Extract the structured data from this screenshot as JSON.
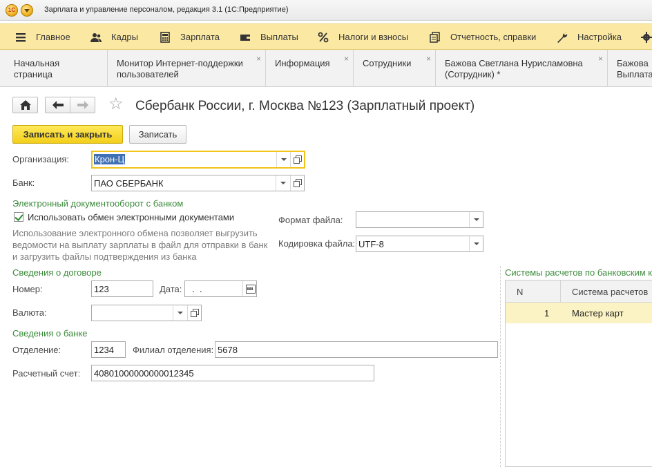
{
  "window": {
    "title": "Зарплата и управление персоналом, редакция 3.1  (1С:Предприятие)",
    "logo_text": "1С"
  },
  "sections": [
    {
      "label": "Главное",
      "icon": "menu-icon"
    },
    {
      "label": "Кадры",
      "icon": "people-icon"
    },
    {
      "label": "Зарплата",
      "icon": "calculator-icon"
    },
    {
      "label": "Выплаты",
      "icon": "wallet-icon"
    },
    {
      "label": "Налоги и взносы",
      "icon": "percent-icon"
    },
    {
      "label": "Отчетность, справки",
      "icon": "reports-icon"
    },
    {
      "label": "Настройка",
      "icon": "wrench-icon"
    }
  ],
  "tabs": [
    {
      "label": "Начальная страница",
      "close": ""
    },
    {
      "label": "Монитор Интернет-поддержки пользователей",
      "close": "×"
    },
    {
      "label": "Информация",
      "close": "×"
    },
    {
      "label": "Сотрудники",
      "close": "×"
    },
    {
      "label": "Бажова Светлана Нурисламовна (Сотрудник) *",
      "close": "×"
    },
    {
      "label": "Бажова Выплата",
      "close": ""
    }
  ],
  "form": {
    "title": "Сбербанк России, г. Москва №123 (Зарплатный проект)",
    "save_close_label": "Записать и закрыть",
    "save_label": "Записать",
    "organization_label": "Организация:",
    "organization_value": "Крон-Ц",
    "bank_label": "Банк:",
    "bank_value": "ПАО СБЕРБАНК",
    "edo_group": "Электронный документооборот с банком",
    "use_edo_label": "Использовать обмен электронными документами",
    "use_edo_checked": true,
    "edo_hint": "Использование электронного обмена позволяет выгрузить ведомости на выплату зарплаты в файл для отправки в банк и загрузить файлы подтверждения из банка",
    "file_format_label": "Формат файла:",
    "file_format_value": "",
    "file_encoding_label": "Кодировка файла:",
    "file_encoding_value": "UTF-8",
    "contract_group": "Сведения о договоре",
    "number_label": "Номер:",
    "number_value": "123",
    "date_label": "Дата:",
    "date_value": "  .  .",
    "currency_label": "Валюта:",
    "currency_value": "",
    "bank_info_group": "Сведения о банке",
    "branch_label": "Отделение:",
    "branch_value": "1234",
    "sub_branch_label": "Филиал отделения:",
    "sub_branch_value": "5678",
    "account_label": "Расчетный счет:",
    "account_value": "40801000000000012345"
  },
  "payment_systems": {
    "title": "Системы расчетов по банковским к",
    "columns": [
      "N",
      "Система расчетов"
    ],
    "rows": [
      {
        "n": "1",
        "system": "Мастер карт"
      }
    ]
  },
  "colors": {
    "sections_bg": "#fbe8a3",
    "primary_button": "#f3cf1b",
    "group_title": "#3b8a3b",
    "selected_row": "#fbf3c4",
    "focus_border": "#f0c419"
  }
}
